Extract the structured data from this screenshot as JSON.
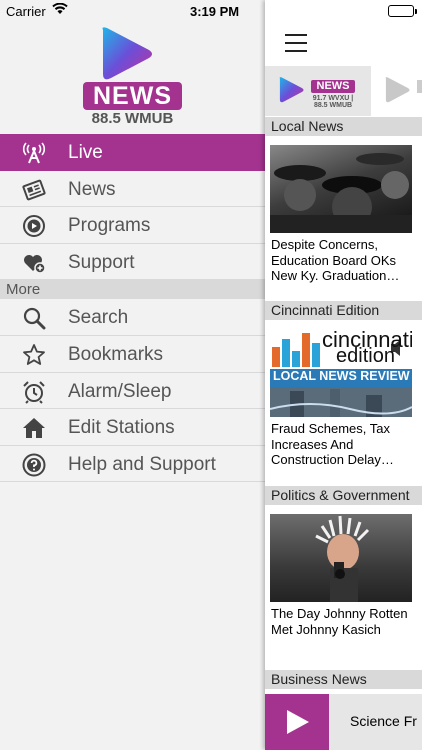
{
  "status_bar": {
    "carrier": "Carrier",
    "time": "3:19 PM"
  },
  "brand": {
    "logo_text": "NEWS",
    "call_sign": "88.5 WMUB",
    "accent_color": "#a3338f"
  },
  "menu": {
    "items": [
      {
        "label": "Live",
        "icon": "radio-tower-icon",
        "active": true
      },
      {
        "label": "News",
        "icon": "newspaper-icon"
      },
      {
        "label": "Programs",
        "icon": "play-circle-icon"
      },
      {
        "label": "Support",
        "icon": "heart-plus-icon"
      }
    ],
    "more_label": "More",
    "more_items": [
      {
        "label": "Search",
        "icon": "search-icon"
      },
      {
        "label": "Bookmarks",
        "icon": "star-icon"
      },
      {
        "label": "Alarm/Sleep",
        "icon": "alarm-clock-icon"
      },
      {
        "label": "Edit Stations",
        "icon": "home-icon"
      },
      {
        "label": "Help and Support",
        "icon": "help-icon"
      }
    ]
  },
  "panel": {
    "station_tab": {
      "logo_text": "NEWS",
      "calls": "91.7 WVXU | 88.5 WMUB"
    },
    "sections": [
      {
        "header": "Local News",
        "story": "Despite Concerns, Education Board OKs New Ky. Graduation…"
      },
      {
        "header": "Cincinnati Edition",
        "story": "Fraud Schemes, Tax Increases And Construction Delay…",
        "thumb_text_1": "cincinnati",
        "thumb_text_2": "edition",
        "thumb_text_3": "LOCAL NEWS REVIEW"
      },
      {
        "header": "Politics & Government",
        "story": "The Day Johnny Rotten Met Johnny Kasich"
      },
      {
        "header": "Business News"
      }
    ],
    "player": {
      "now_playing": "Science Fr"
    }
  }
}
